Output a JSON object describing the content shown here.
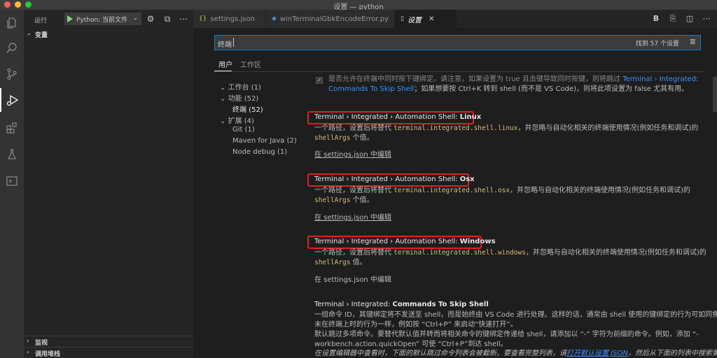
{
  "window": {
    "title": "设置 — python"
  },
  "activity_bar": {
    "items": [
      {
        "icon": "files-icon"
      },
      {
        "icon": "search-icon"
      },
      {
        "icon": "source-control-icon"
      },
      {
        "icon": "run-debug-icon",
        "active": true
      },
      {
        "icon": "extensions-icon"
      },
      {
        "icon": "testing-icon"
      },
      {
        "icon": "terminal-icon"
      }
    ]
  },
  "sidebar": {
    "title": "运行",
    "run_config": "Python: 当前文件",
    "sections": {
      "variables": "变量",
      "watch": "监视",
      "call_stack": "调用堆栈"
    }
  },
  "tabs": [
    {
      "label": "settings.json",
      "icon": "json-icon"
    },
    {
      "label": "winTerminalGbkEncodeError.py",
      "icon": "python-icon"
    },
    {
      "label": "设置",
      "icon": "file-icon",
      "active": true,
      "close": "✕"
    }
  ],
  "search": {
    "value": "终端",
    "result_count": "找到 57 个设置"
  },
  "scopes": {
    "user": "用户",
    "workspace": "工作区"
  },
  "toc": [
    {
      "label": "工作台 (1)",
      "chevron": "⌄"
    },
    {
      "label": "功能 (52)",
      "chevron": "⌄"
    },
    {
      "label": "终端 (52)",
      "chevron": ""
    },
    {
      "label": "扩展 (4)",
      "chevron": "⌄"
    },
    {
      "label": "Git (1)",
      "chevron": ""
    },
    {
      "label": "Maven for Java (2)",
      "chevron": ""
    },
    {
      "label": "Node debug (1)",
      "chevron": ""
    }
  ],
  "settings": {
    "top_partial": {
      "line1_prefix": "是否允许在终端中同时按下键绑定。请注意，如果设置为 true 且击键导致同时按键，则将跳过 ",
      "line1_link": "Terminal › Integrated:",
      "line2_link": "Commands To Skip Shell",
      "line2_rest": "；如果想要按 Ctrl+K 转到 shell (而不是 VS Code)，则将此项设置为 false 尤其有用。"
    },
    "linux": {
      "prefix": "Terminal › Integrated › Automation Shell: ",
      "name": "Linux",
      "desc_a": "一个路径，设置后将替代 ",
      "code": "terminal.integrated.shell.linux",
      "desc_b": "，并忽略与自动化相关的终端使用情况(例如任务和调试)的",
      "code2": "shellArgs",
      "desc_c": " 个值。",
      "edit": "在 settings.json 中编辑"
    },
    "osx": {
      "prefix": "Terminal › Integrated › Automation Shell: ",
      "name": "Osx",
      "desc_a": "一个路径，设置后将替代 ",
      "code": "terminal.integrated.shell.osx",
      "desc_b": "，并忽略与自动化相关的终端使用情况(例如任务和调试)的",
      "code2": "shellArgs",
      "desc_c": " 个值。",
      "edit": "在 settings.json 中编辑"
    },
    "windows": {
      "prefix": "Terminal › Integrated › Automation Shell: ",
      "name": "Windows",
      "desc_a": "一个路径，设置后将替代 ",
      "code": "terminal.integrated.shell.windows",
      "desc_b": "，并忽略与自动化相关的终端使用情况(例如任务和调试)的",
      "code2": "shellArgs",
      "desc_c": " 值。",
      "edit": "在 settings.json 中编辑"
    },
    "skip_shell": {
      "prefix": "Terminal › Integrated: ",
      "name": "Commands To Skip Shell",
      "line1": "一组命令 ID，其键绑定将不发送至 shell，而是始终由 VS Code 进行处理。这样的话，通常由 shell 使用的键绑定的行为可如同焦点",
      "line2": "未在终端上时的行为一样，例如按 “Ctrl+P” 来启动“快速打开”。",
      "line3": "默认跳过多项命令。要替代默认值并转而将相关命令的键绑定传递给 shell，请添加以 “-” 字符为前缀的命令。例如，添加 “-",
      "line4": "workbench.action.quickOpen” 可使 “Ctrl+P”到达 shell。",
      "line5a": "在设置编辑器中查看时，下面的默认跳过命令列表会被截断。要查看完整列表，请",
      "line5_link": "打开默认设置 JSON",
      "line5b": "，然后从下面的列表中搜索第"
    }
  }
}
